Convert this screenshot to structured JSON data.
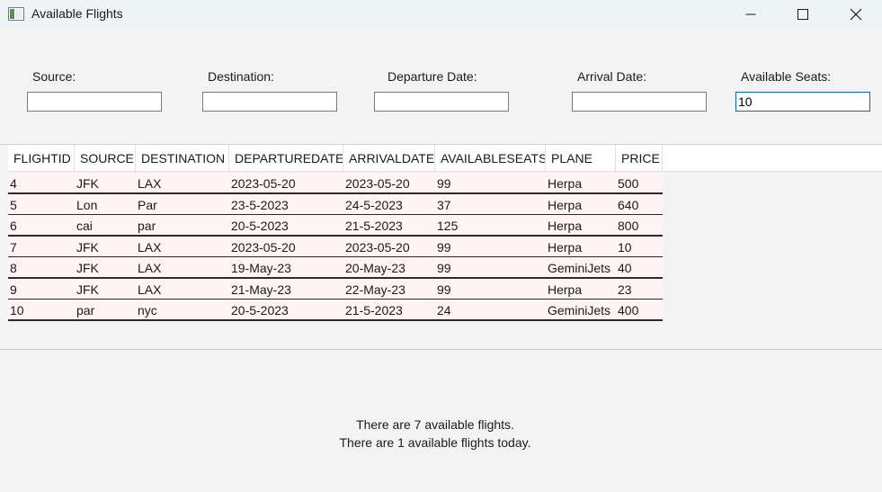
{
  "window": {
    "title": "Available Flights"
  },
  "filters": {
    "source": {
      "label": "Source:",
      "value": ""
    },
    "destination": {
      "label": "Destination:",
      "value": ""
    },
    "departure_date": {
      "label": "Departure Date:",
      "value": ""
    },
    "arrival_date": {
      "label": "Arrival Date:",
      "value": ""
    },
    "available_seats": {
      "label": "Available Seats:",
      "value": "10"
    }
  },
  "table": {
    "columns": [
      "FLIGHTID",
      "SOURCE",
      "DESTINATION",
      "DEPARTUREDATE",
      "ARRIVALDATE",
      "AVAILABLESEATS",
      "PLANE",
      "PRICE"
    ],
    "rows": [
      [
        "4",
        "JFK",
        "LAX",
        "2023-05-20",
        "2023-05-20",
        "99",
        "Herpa",
        "500"
      ],
      [
        "5",
        "Lon",
        "Par",
        "23-5-2023",
        "24-5-2023",
        "37",
        "Herpa",
        "640"
      ],
      [
        "6",
        "cai",
        "par",
        "20-5-2023",
        "21-5-2023",
        "125",
        "Herpa",
        "800"
      ],
      [
        "7",
        "JFK",
        "LAX",
        "2023-05-20",
        "2023-05-20",
        "99",
        "Herpa",
        "10"
      ],
      [
        "8",
        "JFK",
        "LAX",
        "19-May-23",
        "20-May-23",
        "99",
        "GeminiJets",
        "40"
      ],
      [
        "9",
        "JFK",
        "LAX",
        "21-May-23",
        "22-May-23",
        "99",
        "Herpa",
        "23"
      ],
      [
        "10",
        "par",
        "nyc",
        "20-5-2023",
        "21-5-2023",
        "24",
        "GeminiJets",
        "400"
      ]
    ]
  },
  "status": {
    "total_line": "There are 7 available flights.",
    "today_line": "There are 1 available flights today."
  },
  "colors": {
    "row_background": "#fff3f3",
    "row_separator": "#2a2a2a",
    "focus_border": "#0a64c8",
    "window_background": "#f3f3f3",
    "titlebar_background": "#eef3f6"
  },
  "icons": {
    "app": "window-app-icon",
    "minimize": "minimize-icon",
    "maximize": "maximize-icon",
    "close": "close-icon"
  }
}
